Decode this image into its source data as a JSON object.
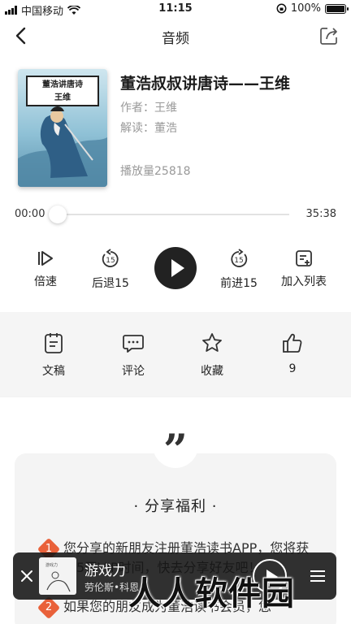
{
  "status_bar": {
    "carrier": "中国移动",
    "time": "11:15",
    "battery": "100%"
  },
  "nav": {
    "title": "音频"
  },
  "book": {
    "cover_title": "董浩讲唐诗",
    "cover_subtitle": "王维",
    "title": "董浩叔叔讲唐诗——王维",
    "author_label": "作者：",
    "author": "王维",
    "reader_label": "解读：",
    "reader": "董浩",
    "plays": "播放量25818"
  },
  "player": {
    "current_time": "00:00",
    "total_time": "35:38",
    "progress": 0,
    "controls": {
      "speed": "倍速",
      "rewind": "后退15",
      "forward": "前进15",
      "add_to_list": "加入列表",
      "rewind_num": "15",
      "forward_num": "15"
    }
  },
  "actions": {
    "manuscript": "文稿",
    "comment": "评论",
    "favorite": "收藏",
    "likes": "9"
  },
  "share_card": {
    "quote_mark": "”",
    "title": "·  分享福利  ·",
    "items": [
      {
        "num": "1",
        "text": "您分享的新朋友注册董浩读书APP，您将获得5天VIP时间，快去分享好友吧！"
      },
      {
        "num": "2",
        "text": "如果您的朋友成为董浩读书会员，您"
      }
    ]
  },
  "mini_player": {
    "title": "游戏力",
    "author": "劳伦斯•科恩",
    "thumb_text": "游戏力"
  },
  "watermark": "人人软件园",
  "colors": {
    "accent": "#e9613a",
    "dark": "#222222",
    "gray_bg": "#f2f2f2"
  }
}
